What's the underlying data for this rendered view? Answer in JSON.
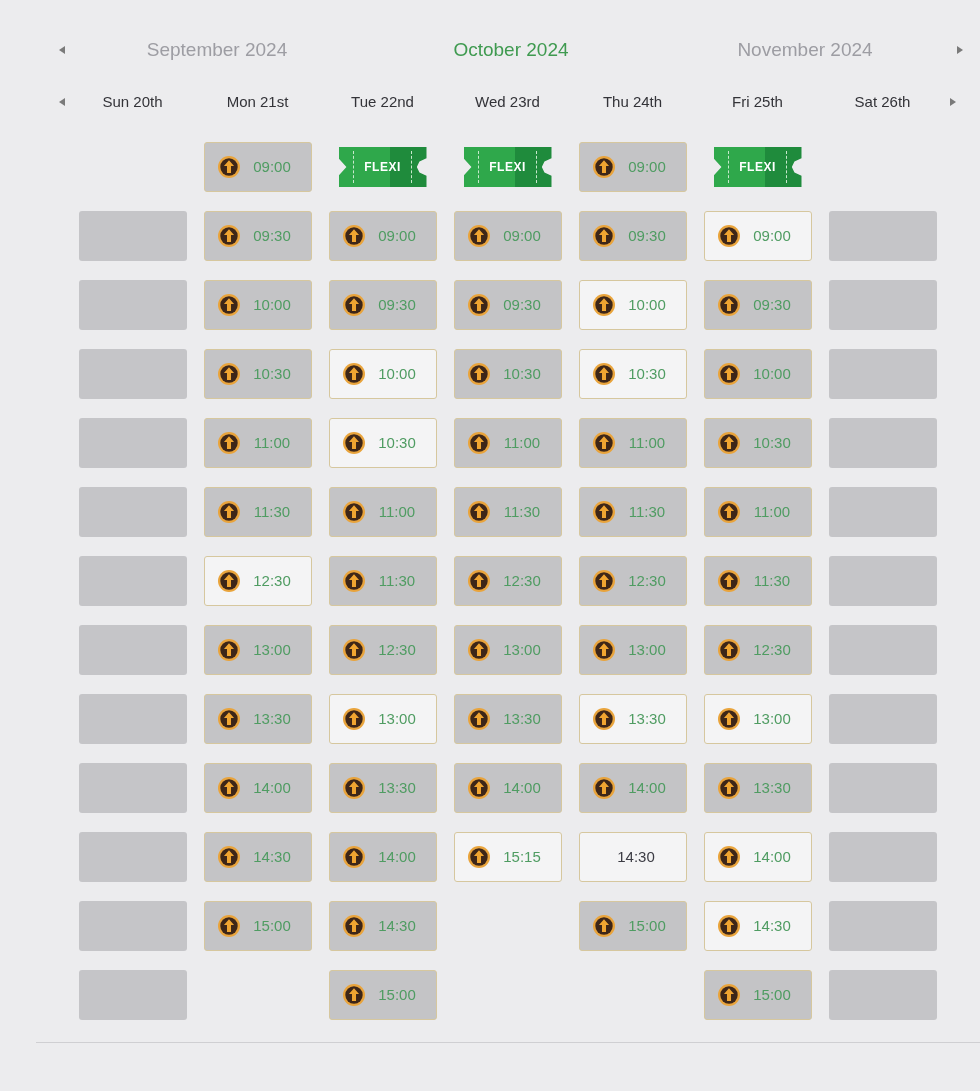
{
  "month_nav": {
    "months": [
      {
        "label": "September 2024",
        "selected": false
      },
      {
        "label": "October 2024",
        "selected": true
      },
      {
        "label": "November 2024",
        "selected": false
      }
    ]
  },
  "days": [
    {
      "label": "Sun 20th",
      "slots": [
        {
          "kind": "blank"
        },
        {
          "kind": "blank"
        },
        {
          "kind": "blank"
        },
        {
          "kind": "blank"
        },
        {
          "kind": "blank"
        },
        {
          "kind": "blank"
        },
        {
          "kind": "blank"
        },
        {
          "kind": "blank"
        },
        {
          "kind": "blank"
        },
        {
          "kind": "blank"
        },
        {
          "kind": "blank"
        },
        {
          "kind": "blank"
        }
      ]
    },
    {
      "label": "Mon 21st",
      "slots": [
        {
          "kind": "time",
          "time": "09:00",
          "greyed": true,
          "icon": true
        },
        {
          "kind": "time",
          "time": "09:30",
          "greyed": true,
          "icon": true
        },
        {
          "kind": "time",
          "time": "10:00",
          "greyed": true,
          "icon": true
        },
        {
          "kind": "time",
          "time": "10:30",
          "greyed": true,
          "icon": true
        },
        {
          "kind": "time",
          "time": "11:00",
          "greyed": true,
          "icon": true
        },
        {
          "kind": "time",
          "time": "11:30",
          "greyed": true,
          "icon": true
        },
        {
          "kind": "time",
          "time": "12:30",
          "greyed": false,
          "icon": true
        },
        {
          "kind": "time",
          "time": "13:00",
          "greyed": true,
          "icon": true
        },
        {
          "kind": "time",
          "time": "13:30",
          "greyed": true,
          "icon": true
        },
        {
          "kind": "time",
          "time": "14:00",
          "greyed": true,
          "icon": true
        },
        {
          "kind": "time",
          "time": "14:30",
          "greyed": true,
          "icon": true
        },
        {
          "kind": "time",
          "time": "15:00",
          "greyed": true,
          "icon": true
        }
      ]
    },
    {
      "label": "Tue 22nd",
      "slots": [
        {
          "kind": "flexi",
          "label": "FLEXI"
        },
        {
          "kind": "time",
          "time": "09:00",
          "greyed": true,
          "icon": true
        },
        {
          "kind": "time",
          "time": "09:30",
          "greyed": true,
          "icon": true
        },
        {
          "kind": "time",
          "time": "10:00",
          "greyed": false,
          "icon": true
        },
        {
          "kind": "time",
          "time": "10:30",
          "greyed": false,
          "icon": true
        },
        {
          "kind": "time",
          "time": "11:00",
          "greyed": true,
          "icon": true
        },
        {
          "kind": "time",
          "time": "11:30",
          "greyed": true,
          "icon": true
        },
        {
          "kind": "time",
          "time": "12:30",
          "greyed": true,
          "icon": true
        },
        {
          "kind": "time",
          "time": "13:00",
          "greyed": false,
          "icon": true
        },
        {
          "kind": "time",
          "time": "13:30",
          "greyed": true,
          "icon": true
        },
        {
          "kind": "time",
          "time": "14:00",
          "greyed": true,
          "icon": true
        },
        {
          "kind": "time",
          "time": "14:30",
          "greyed": true,
          "icon": true
        },
        {
          "kind": "time",
          "time": "15:00",
          "greyed": true,
          "icon": true
        }
      ]
    },
    {
      "label": "Wed 23rd",
      "slots": [
        {
          "kind": "flexi",
          "label": "FLEXI"
        },
        {
          "kind": "time",
          "time": "09:00",
          "greyed": true,
          "icon": true
        },
        {
          "kind": "time",
          "time": "09:30",
          "greyed": true,
          "icon": true
        },
        {
          "kind": "time",
          "time": "10:30",
          "greyed": true,
          "icon": true
        },
        {
          "kind": "time",
          "time": "11:00",
          "greyed": true,
          "icon": true
        },
        {
          "kind": "time",
          "time": "11:30",
          "greyed": true,
          "icon": true
        },
        {
          "kind": "time",
          "time": "12:30",
          "greyed": true,
          "icon": true
        },
        {
          "kind": "time",
          "time": "13:00",
          "greyed": true,
          "icon": true
        },
        {
          "kind": "time",
          "time": "13:30",
          "greyed": true,
          "icon": true
        },
        {
          "kind": "time",
          "time": "14:00",
          "greyed": true,
          "icon": true
        },
        {
          "kind": "time",
          "time": "15:15",
          "greyed": false,
          "icon": true
        }
      ]
    },
    {
      "label": "Thu 24th",
      "slots": [
        {
          "kind": "time",
          "time": "09:00",
          "greyed": true,
          "icon": true
        },
        {
          "kind": "time",
          "time": "09:30",
          "greyed": true,
          "icon": true
        },
        {
          "kind": "time",
          "time": "10:00",
          "greyed": false,
          "icon": true
        },
        {
          "kind": "time",
          "time": "10:30",
          "greyed": false,
          "icon": true
        },
        {
          "kind": "time",
          "time": "11:00",
          "greyed": true,
          "icon": true
        },
        {
          "kind": "time",
          "time": "11:30",
          "greyed": true,
          "icon": true
        },
        {
          "kind": "time",
          "time": "12:30",
          "greyed": true,
          "icon": true
        },
        {
          "kind": "time",
          "time": "13:00",
          "greyed": true,
          "icon": true
        },
        {
          "kind": "time",
          "time": "13:30",
          "greyed": false,
          "icon": true
        },
        {
          "kind": "time",
          "time": "14:00",
          "greyed": true,
          "icon": true
        },
        {
          "kind": "time",
          "time": "14:30",
          "greyed": false,
          "icon": false
        },
        {
          "kind": "time",
          "time": "15:00",
          "greyed": true,
          "icon": true
        }
      ]
    },
    {
      "label": "Fri 25th",
      "slots": [
        {
          "kind": "flexi",
          "label": "FLEXI"
        },
        {
          "kind": "time",
          "time": "09:00",
          "greyed": false,
          "icon": true
        },
        {
          "kind": "time",
          "time": "09:30",
          "greyed": true,
          "icon": true
        },
        {
          "kind": "time",
          "time": "10:00",
          "greyed": true,
          "icon": true
        },
        {
          "kind": "time",
          "time": "10:30",
          "greyed": true,
          "icon": true
        },
        {
          "kind": "time",
          "time": "11:00",
          "greyed": true,
          "icon": true
        },
        {
          "kind": "time",
          "time": "11:30",
          "greyed": true,
          "icon": true
        },
        {
          "kind": "time",
          "time": "12:30",
          "greyed": true,
          "icon": true
        },
        {
          "kind": "time",
          "time": "13:00",
          "greyed": false,
          "icon": true
        },
        {
          "kind": "time",
          "time": "13:30",
          "greyed": true,
          "icon": true
        },
        {
          "kind": "time",
          "time": "14:00",
          "greyed": false,
          "icon": true
        },
        {
          "kind": "time",
          "time": "14:30",
          "greyed": false,
          "icon": true
        },
        {
          "kind": "time",
          "time": "15:00",
          "greyed": true,
          "icon": true
        }
      ]
    },
    {
      "label": "Sat 26th",
      "slots": [
        {
          "kind": "blank"
        },
        {
          "kind": "blank"
        },
        {
          "kind": "blank"
        },
        {
          "kind": "blank"
        },
        {
          "kind": "blank"
        },
        {
          "kind": "blank"
        },
        {
          "kind": "blank"
        },
        {
          "kind": "blank"
        },
        {
          "kind": "blank"
        },
        {
          "kind": "blank"
        },
        {
          "kind": "blank"
        },
        {
          "kind": "blank"
        }
      ]
    }
  ]
}
